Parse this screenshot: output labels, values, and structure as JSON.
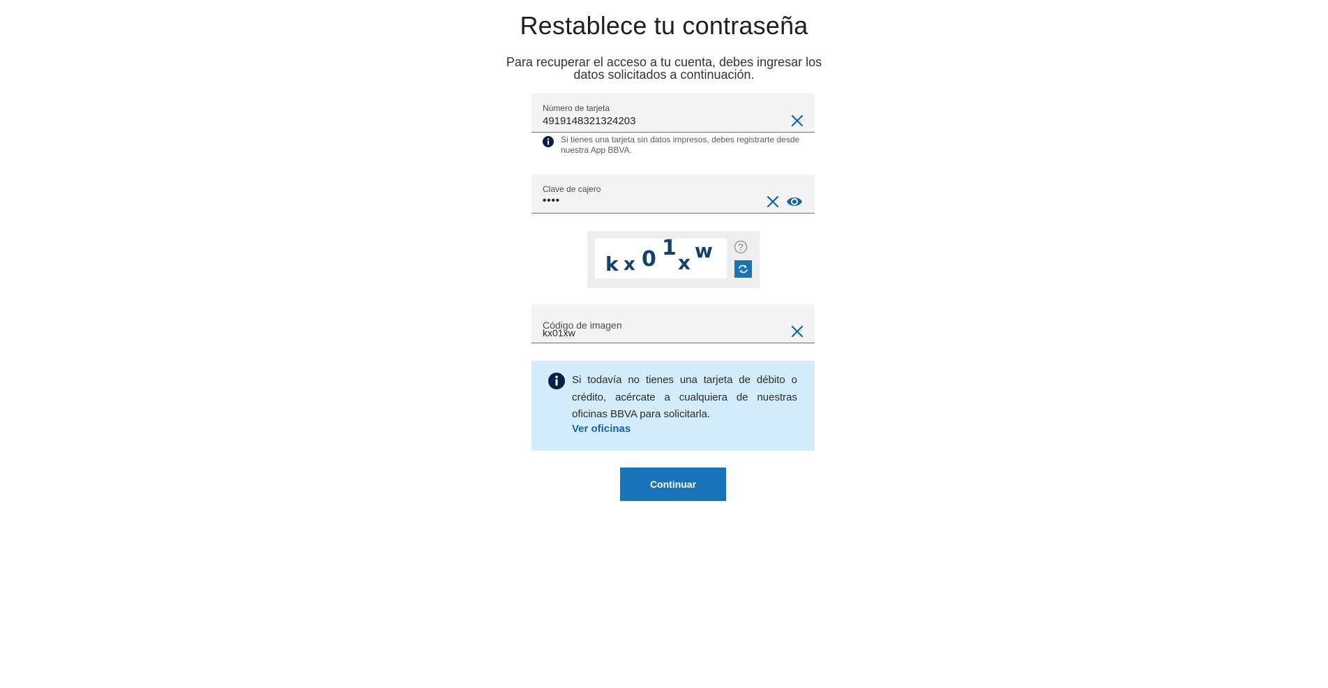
{
  "page": {
    "title": "Restablece tu contraseña",
    "subtitle": "Para recuperar el acceso a tu cuenta, debes ingresar los datos solicitados a continuación."
  },
  "card_field": {
    "label": "Número de tarjeta",
    "value": "4919148321324203",
    "clear_icon": "close-icon",
    "hint_icon": "info-icon",
    "hint": "Si tienes una tarjeta sin datos impresos, debes registrarte desde nuestra App BBVA."
  },
  "pin_field": {
    "label": "Clave de cajero",
    "value": "••••",
    "clear_icon": "close-icon",
    "reveal_icon": "eye-icon"
  },
  "captcha": {
    "characters": [
      "k",
      "x",
      "0",
      "1",
      "x",
      "w"
    ],
    "help_icon": "question-icon",
    "refresh_icon": "refresh-icon"
  },
  "image_code_field": {
    "label": "Código de imagen",
    "value": "kx01xw",
    "clear_icon": "close-icon"
  },
  "info": {
    "icon": "info-icon",
    "text": "Si todavía no tienes una tarjeta de débito o crédito, acércate a cualquiera de nuestras oficinas BBVA para solicitarla.",
    "link": "Ver oficinas"
  },
  "actions": {
    "continue_label": "Continuar"
  },
  "colors": {
    "primary": "#1973b8",
    "link": "#1464a5",
    "navy": "#072146",
    "info_bg": "#d4edfc",
    "field_bg": "#f4f4f4"
  }
}
